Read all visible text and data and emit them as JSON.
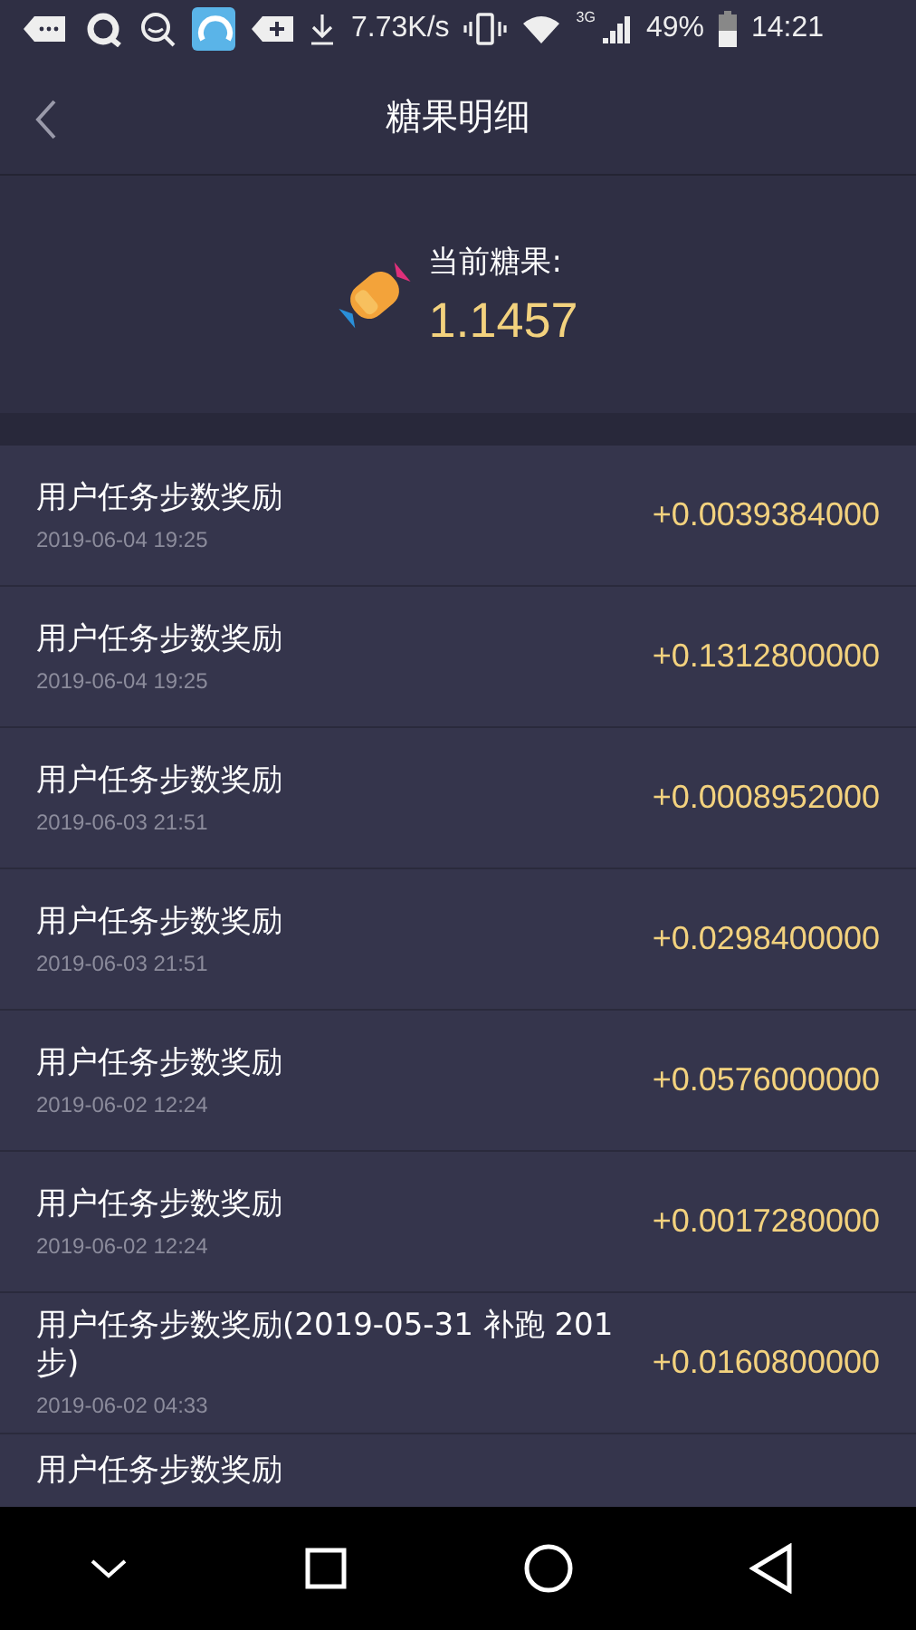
{
  "status_bar": {
    "speed": "7.73K/s",
    "network": "3G",
    "battery": "49%",
    "time": "14:21"
  },
  "header": {
    "title": "糖果明细"
  },
  "summary": {
    "label": "当前糖果:",
    "value": "1.1457"
  },
  "records": [
    {
      "title": "用户任务步数奖励",
      "time": "2019-06-04 19:25",
      "amount": "+0.0039384000"
    },
    {
      "title": "用户任务步数奖励",
      "time": "2019-06-04 19:25",
      "amount": "+0.1312800000"
    },
    {
      "title": "用户任务步数奖励",
      "time": "2019-06-03 21:51",
      "amount": "+0.0008952000"
    },
    {
      "title": "用户任务步数奖励",
      "time": "2019-06-03 21:51",
      "amount": "+0.0298400000"
    },
    {
      "title": "用户任务步数奖励",
      "time": "2019-06-02 12:24",
      "amount": "+0.0576000000"
    },
    {
      "title": "用户任务步数奖励",
      "time": "2019-06-02 12:24",
      "amount": "+0.0017280000"
    },
    {
      "title": "用户任务步数奖励(2019-05-31 补跑 201步)",
      "time": "2019-06-02 04:33",
      "amount": "+0.0160800000"
    },
    {
      "title": "用户任务步数奖励"
    }
  ]
}
